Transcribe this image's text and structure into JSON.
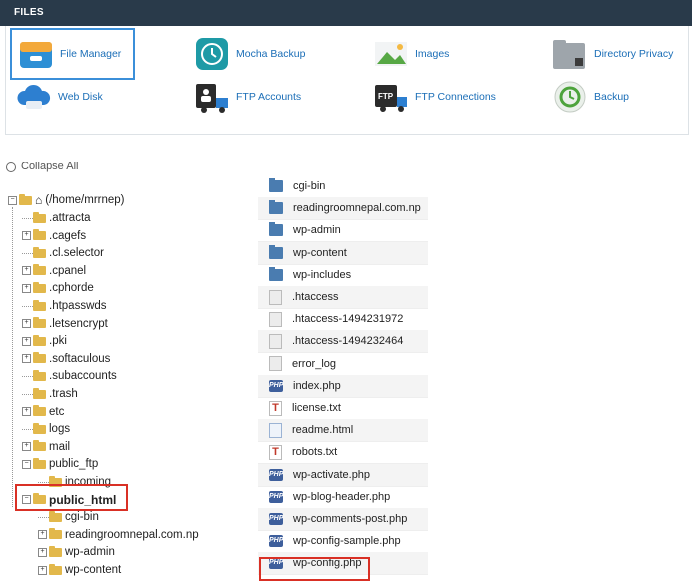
{
  "header": {
    "title": "FILES"
  },
  "tools": [
    {
      "label": "File Manager",
      "icon": "file-manager-icon"
    },
    {
      "label": "Mocha Backup",
      "icon": "mocha-backup-icon"
    },
    {
      "label": "Images",
      "icon": "images-icon"
    },
    {
      "label": "Directory Privacy",
      "icon": "directory-privacy-icon"
    },
    {
      "label": "Web Disk",
      "icon": "web-disk-icon"
    },
    {
      "label": "FTP Accounts",
      "icon": "ftp-accounts-icon"
    },
    {
      "label": "FTP Connections",
      "icon": "ftp-connections-icon"
    },
    {
      "label": "Backup",
      "icon": "backup-icon"
    }
  ],
  "tree": {
    "collapse_label": "Collapse All",
    "root_label": "(/home/mrrnep)",
    "items": [
      ".attracta",
      ".cagefs",
      ".cl.selector",
      ".cpanel",
      ".cphorde",
      ".htpasswds",
      ".letsencrypt",
      ".pki",
      ".softaculous",
      ".subaccounts",
      ".trash",
      "etc",
      "logs",
      "mail",
      "public_ftp",
      "incoming",
      "public_html",
      "cgi-bin",
      "readingroomnepal.com.np",
      "wp-admin",
      "wp-content"
    ]
  },
  "files": [
    "cgi-bin",
    "readingroomnepal.com.np",
    "wp-admin",
    "wp-content",
    "wp-includes",
    ".htaccess",
    ".htaccess-1494231972",
    ".htaccess-1494232464",
    "error_log",
    "index.php",
    "license.txt",
    "readme.html",
    "robots.txt",
    "wp-activate.php",
    "wp-blog-header.php",
    "wp-comments-post.php",
    "wp-config-sample.php",
    "wp-config.php"
  ],
  "colors": {
    "header_bg": "#293a4a",
    "link": "#1b6eb7",
    "highlight": "#d93025",
    "selected": "#3b8fd9"
  }
}
